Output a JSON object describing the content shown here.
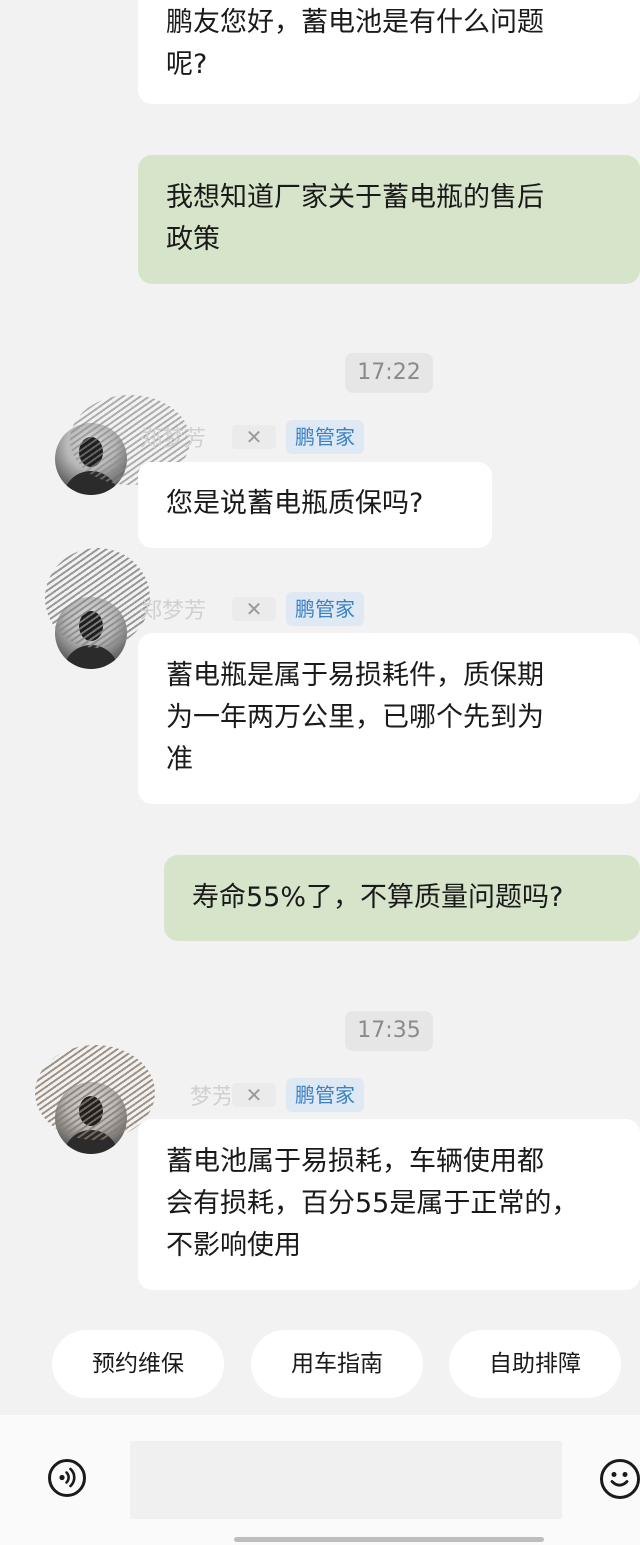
{
  "messages": [
    {
      "text": "鹏友您好，蓄电池是有什么问题\n呢?"
    },
    {
      "text": "我想知道厂家关于蓄电瓶的售后\n政策"
    },
    {
      "text": "您是说蓄电瓶质保吗?"
    },
    {
      "text": "蓄电瓶是属于易损耗件，质保期\n为一年两万公里，已哪个先到为\n准"
    },
    {
      "text": "寿命55%了，不算质量问题吗?"
    },
    {
      "text": "蓄电池属于易损耗，车辆使用都\n会有损耗，百分55是属于正常的，\n不影响使用"
    }
  ],
  "timestamps": [
    "17:22",
    "17:35"
  ],
  "sender": {
    "name": "郑梦芳",
    "name_partial": "梦芳",
    "brand_mark": "✕",
    "tag": "鹏管家"
  },
  "quick_actions": [
    "预约维保",
    "用车指南",
    "自助排障"
  ],
  "colors": {
    "background": "#f2f2f2",
    "incoming_bubble": "#ffffff",
    "outgoing_bubble": "#d6e5ca",
    "tag_text": "#3b82c4",
    "tag_background": "#dfe9f3"
  },
  "icons": [
    "voice-input-icon",
    "emoji-icon"
  ]
}
